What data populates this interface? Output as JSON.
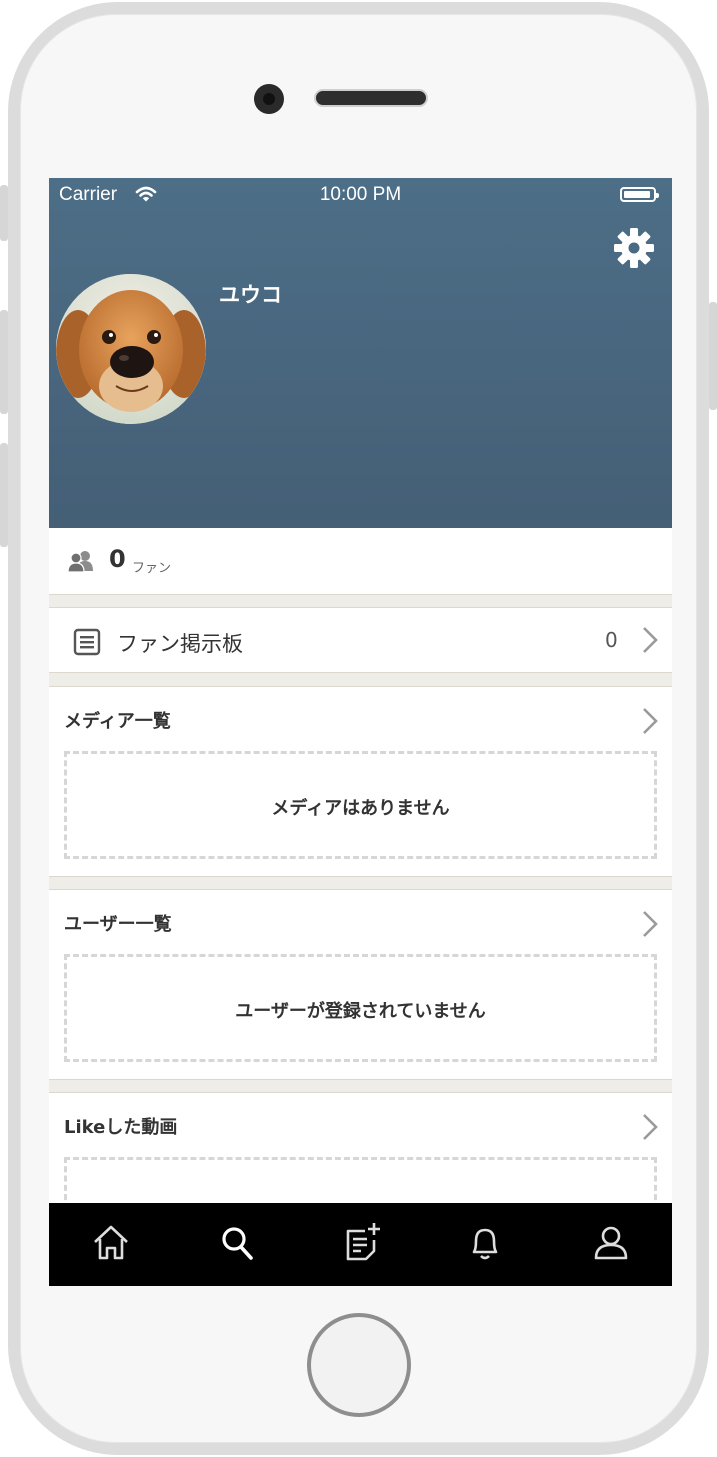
{
  "status_bar": {
    "carrier": "Carrier",
    "time": "10:00 PM"
  },
  "profile": {
    "name": "ユウコ",
    "fan_count": "0",
    "fan_label": "ファン"
  },
  "fan_board": {
    "label": "ファン掲示板",
    "count": "0"
  },
  "sections": [
    {
      "title": "メディア一覧",
      "empty_message": "メディアはありません"
    },
    {
      "title": "ユーザー一覧",
      "empty_message": "ユーザーが登録されていません"
    },
    {
      "title": "Likeした動画",
      "empty_message": ""
    }
  ],
  "tabbar": {
    "items": [
      "home-icon",
      "search-icon",
      "new-post-icon",
      "bell-icon",
      "profile-icon"
    ]
  },
  "colors": {
    "header": "#4a6a83",
    "tabbar": "#000000",
    "background": "#efede8"
  }
}
